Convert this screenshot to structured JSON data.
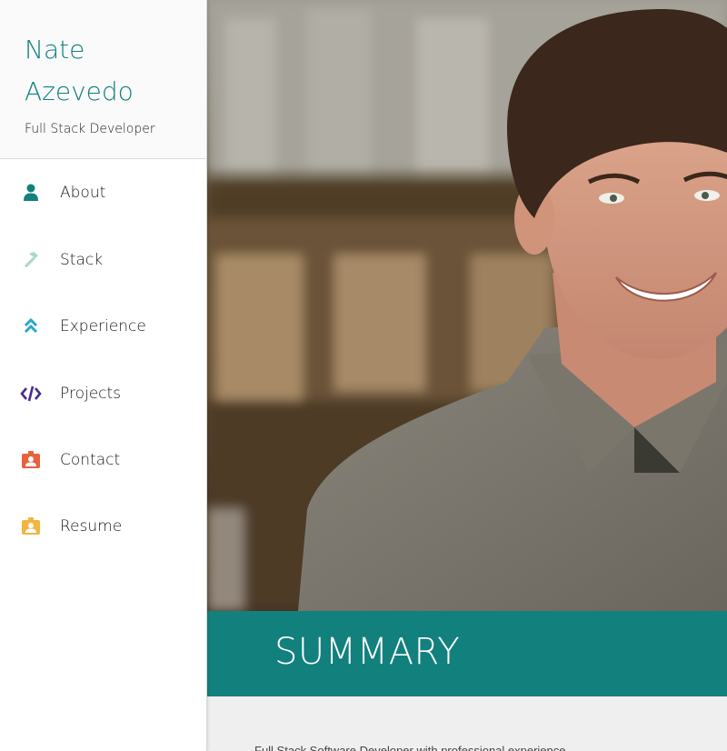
{
  "profile": {
    "first_name": "Nate",
    "last_name": "Azevedo",
    "title": "Full Stack Developer"
  },
  "nav": {
    "items": [
      {
        "label": "About",
        "icon": "person-icon",
        "color": "#12807d"
      },
      {
        "label": "Stack",
        "icon": "hammer-icon",
        "color": "#a9d8c8"
      },
      {
        "label": "Experience",
        "icon": "double-chevron-up-icon",
        "color": "#2aa7c9"
      },
      {
        "label": "Projects",
        "icon": "code-icon",
        "color": "#4a2a8c"
      },
      {
        "label": "Contact",
        "icon": "contact-badge-icon",
        "color": "#e8603c"
      },
      {
        "label": "Resume",
        "icon": "resume-badge-icon",
        "color": "#f2b541"
      }
    ]
  },
  "main": {
    "summary_heading": "SUMMARY",
    "summary_text": "Full Stack Software Developer with professional experience..."
  },
  "colors": {
    "brand": "#12807d",
    "summary_bg": "#efefef"
  }
}
